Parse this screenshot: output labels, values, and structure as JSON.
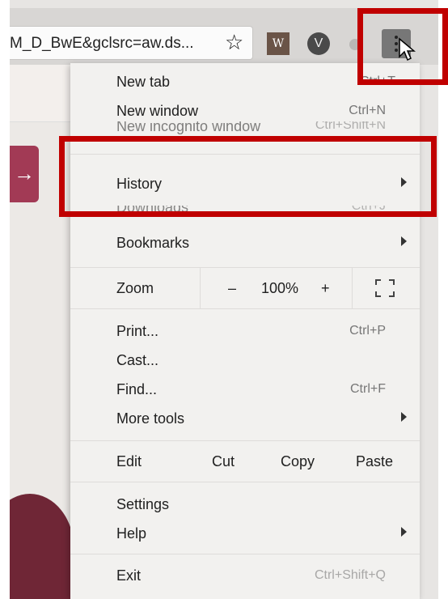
{
  "toolbar": {
    "url": "M_D_BwE&gclsrc=aw.ds...",
    "extensions": {
      "w": "W",
      "v": "V"
    }
  },
  "page": {
    "arrow": "→"
  },
  "menu": {
    "new_tab": {
      "label": "New tab",
      "shortcut": "Ctrl+T"
    },
    "new_window": {
      "label": "New window",
      "shortcut": "Ctrl+N"
    },
    "incognito_partial": {
      "label": "New incognito window",
      "shortcut": "Ctrl+Shift+N"
    },
    "history": {
      "label": "History"
    },
    "downloads_partial": {
      "label": "Downloads",
      "shortcut": "Ctrl+J"
    },
    "bookmarks": {
      "label": "Bookmarks"
    },
    "zoom": {
      "label": "Zoom",
      "minus": "–",
      "value": "100%",
      "plus": "+",
      "fullscreen": "⛶"
    },
    "print": {
      "label": "Print...",
      "shortcut": "Ctrl+P"
    },
    "cast": {
      "label": "Cast..."
    },
    "find": {
      "label": "Find...",
      "shortcut": "Ctrl+F"
    },
    "more_tools": {
      "label": "More tools"
    },
    "edit": {
      "label": "Edit",
      "cut": "Cut",
      "copy": "Copy",
      "paste": "Paste"
    },
    "settings": {
      "label": "Settings"
    },
    "help": {
      "label": "Help"
    },
    "exit": {
      "label": "Exit",
      "shortcut": "Ctrl+Shift+Q"
    }
  },
  "colors": {
    "highlight": "#c00000",
    "accent": "#a23a55"
  }
}
